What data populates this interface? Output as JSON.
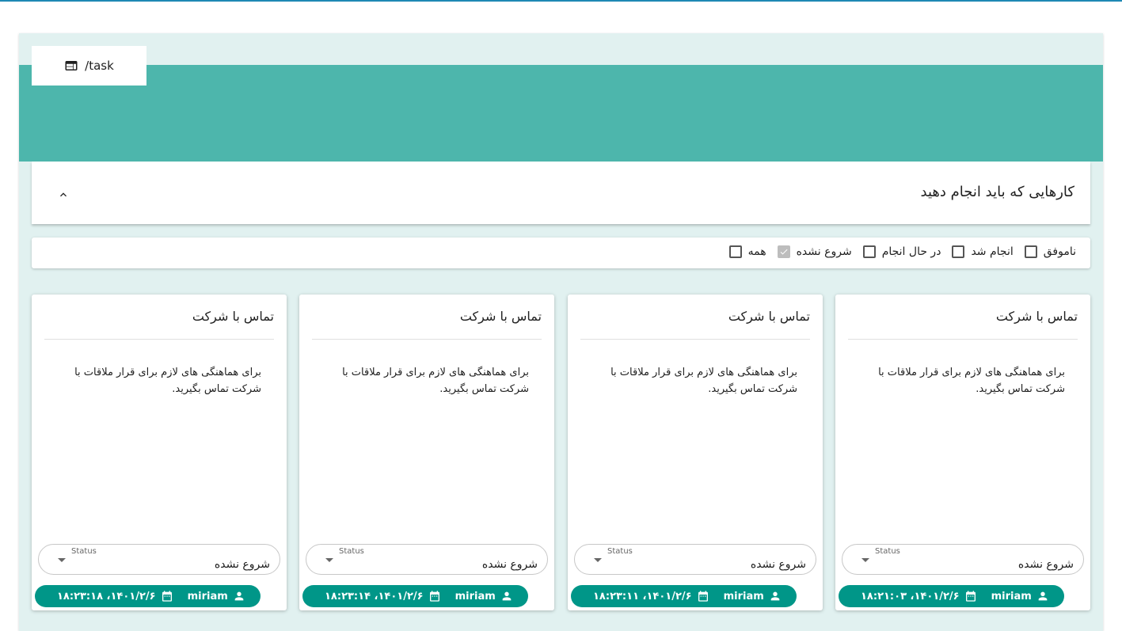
{
  "route_tab": {
    "label": "/task",
    "icon": "web-window-icon"
  },
  "panel": {
    "title": "کارهایی که باید انجام دهید",
    "collapse_icon": "chevron-up-icon"
  },
  "filters": [
    {
      "label": "همه",
      "checked": false
    },
    {
      "label": "شروع نشده",
      "checked": true
    },
    {
      "label": "در حال انجام",
      "checked": false
    },
    {
      "label": "انجام شد",
      "checked": false
    },
    {
      "label": "ناموفق",
      "checked": false
    }
  ],
  "cards": [
    {
      "title": "تماس با شرکت",
      "description": "برای هماهنگی های لازم برای قرار ملاقات با شرکت تماس بگیرید.",
      "status_label": "Status",
      "status_value": "شروع نشده",
      "user": "miriam",
      "datetime": "۱۴۰۱/۲/۶، ۱۸:۲۱:۰۳"
    },
    {
      "title": "تماس با شرکت",
      "description": "برای هماهنگی های لازم برای قرار ملاقات با شرکت تماس بگیرید.",
      "status_label": "Status",
      "status_value": "شروع نشده",
      "user": "miriam",
      "datetime": "۱۴۰۱/۲/۶، ۱۸:۲۳:۱۱"
    },
    {
      "title": "تماس با شرکت",
      "description": "برای هماهنگی های لازم برای قرار ملاقات با شرکت تماس بگیرید.",
      "status_label": "Status",
      "status_value": "شروع نشده",
      "user": "miriam",
      "datetime": "۱۴۰۱/۲/۶، ۱۸:۲۳:۱۴"
    },
    {
      "title": "تماس با شرکت",
      "description": "برای هماهنگی های لازم برای قرار ملاقات با شرکت تماس بگیرید.",
      "status_label": "Status",
      "status_value": "شروع نشده",
      "user": "miriam",
      "datetime": "۱۴۰۱/۲/۶، ۱۸:۲۳:۱۸"
    }
  ],
  "colors": {
    "banner": "#4db6ac",
    "background": "#e1f1f0",
    "chip": "#009688",
    "top_line": "#1e88b4"
  }
}
